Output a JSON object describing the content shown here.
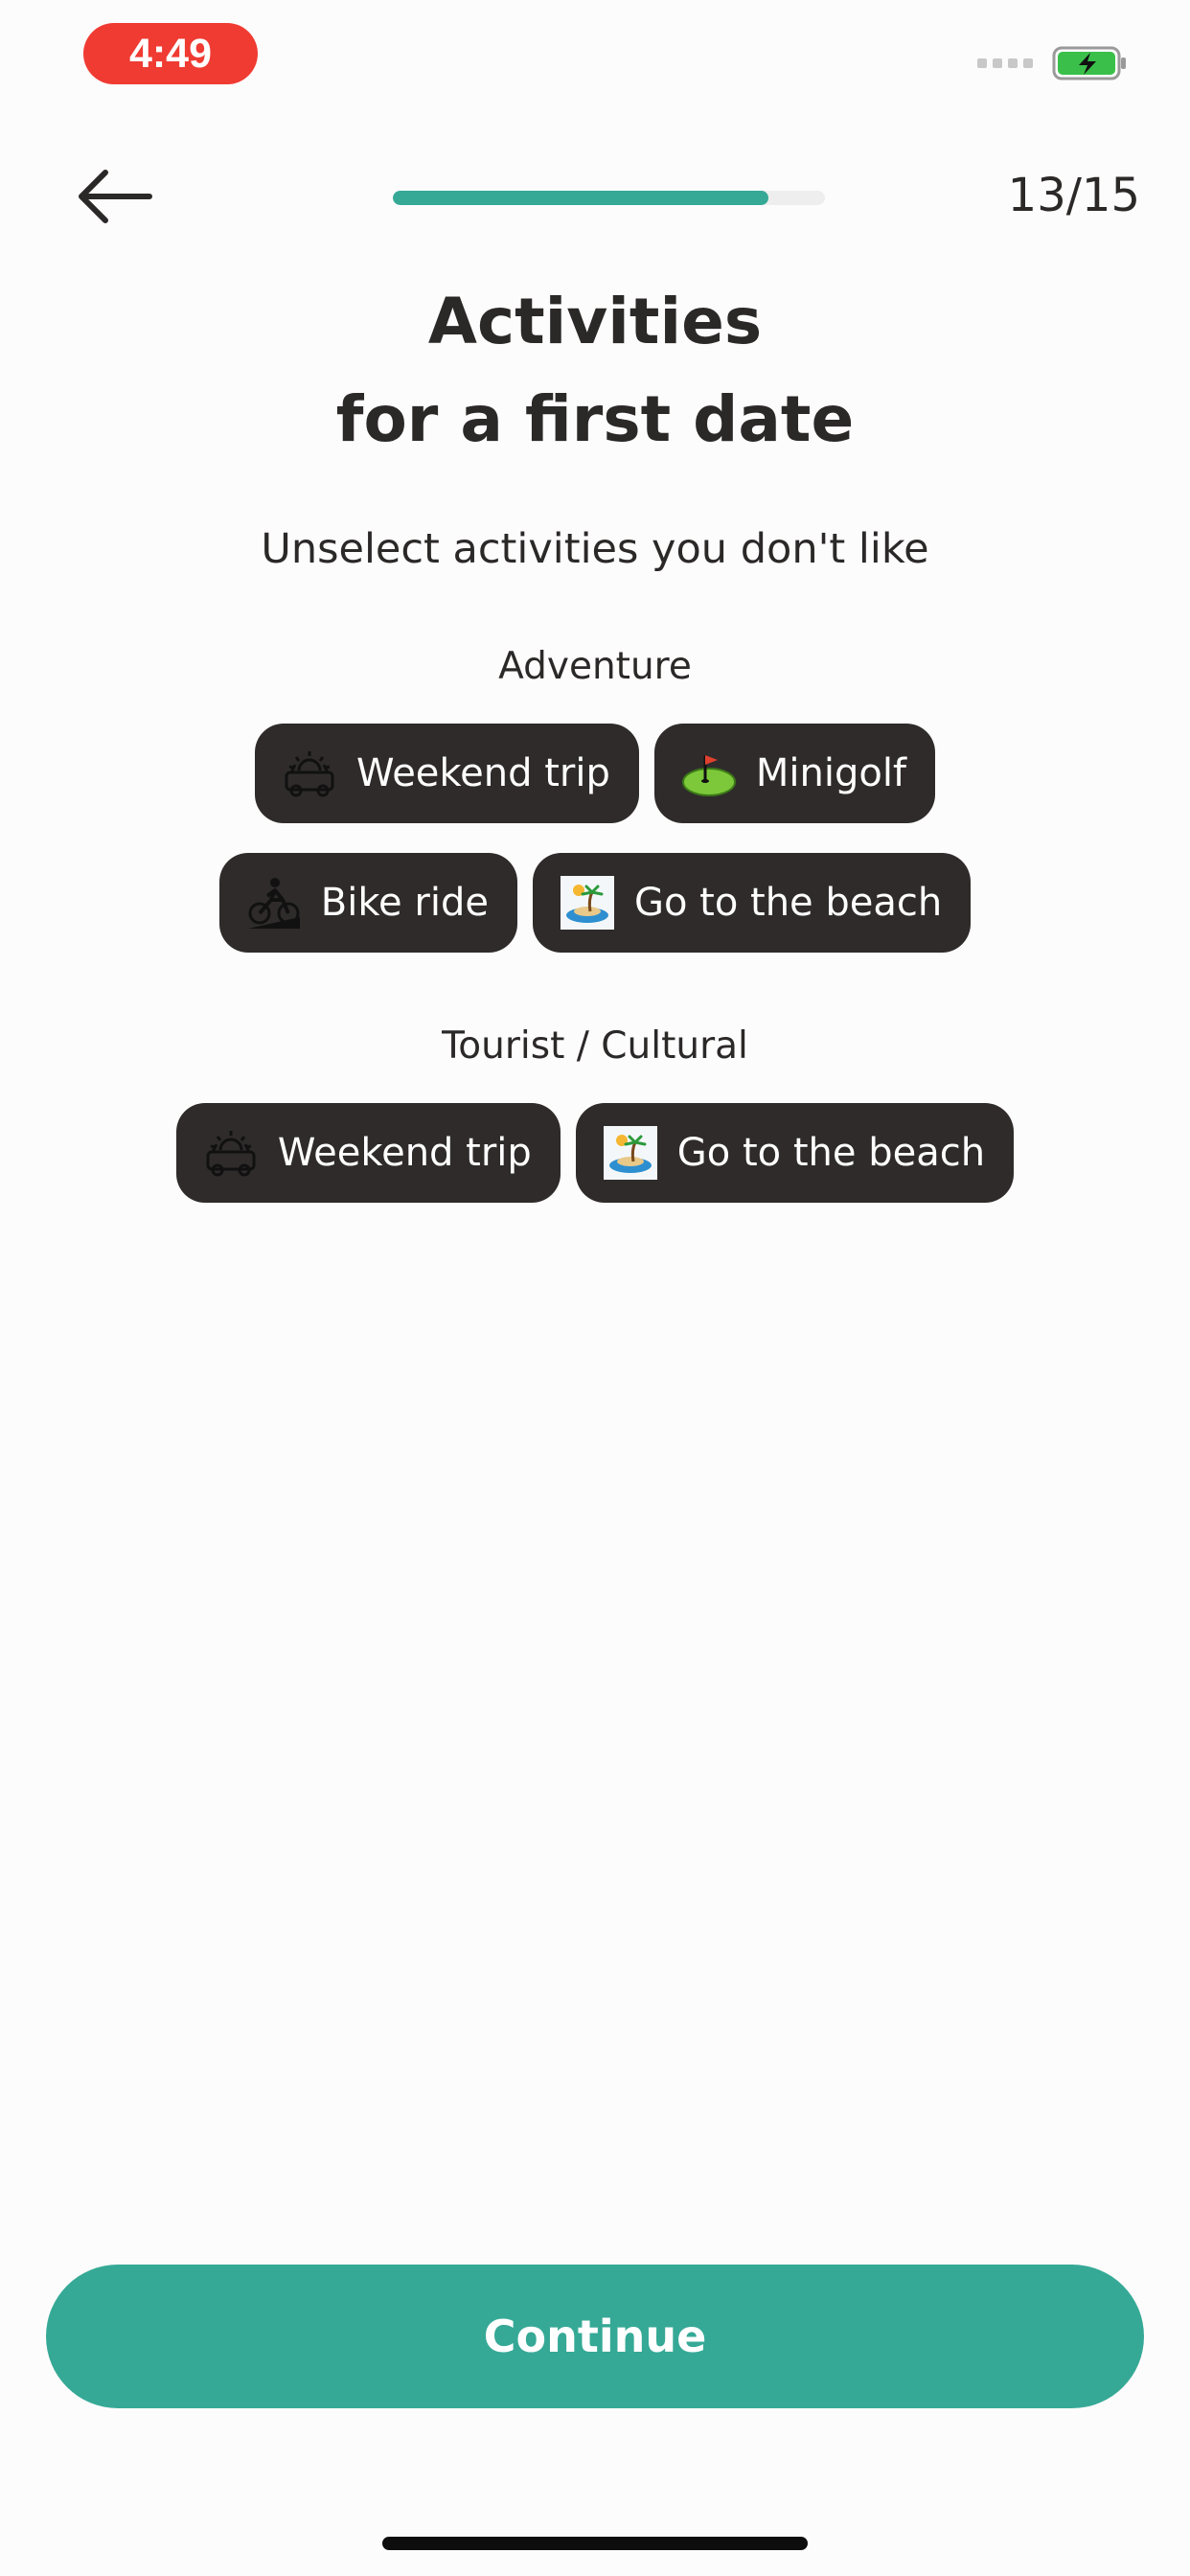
{
  "status_bar": {
    "time": "4:49"
  },
  "header": {
    "step_counter": "13/15",
    "progress": 0.87
  },
  "title": {
    "line1": "Activities",
    "line2": "for a first date"
  },
  "subtitle": "Unselect activities you don't like",
  "sections": [
    {
      "label": "Adventure",
      "rows": [
        [
          {
            "label": "Weekend trip",
            "icon": "car-sunrise-icon"
          },
          {
            "label": "Minigolf",
            "icon": "golf-green-icon"
          }
        ],
        [
          {
            "label": "Bike ride",
            "icon": "cyclist-icon"
          },
          {
            "label": "Go to the beach",
            "icon": "beach-island-icon"
          }
        ]
      ]
    },
    {
      "label": "Tourist / Cultural",
      "rows": [
        [
          {
            "label": "Weekend trip",
            "icon": "car-sunrise-icon"
          },
          {
            "label": "Go to the beach",
            "icon": "beach-island-icon"
          }
        ]
      ]
    }
  ],
  "footer": {
    "continue_label": "Continue"
  },
  "colors": {
    "accent": "#35a996",
    "chip_bg": "#2f2b2b",
    "status_red": "#ef3b32"
  }
}
